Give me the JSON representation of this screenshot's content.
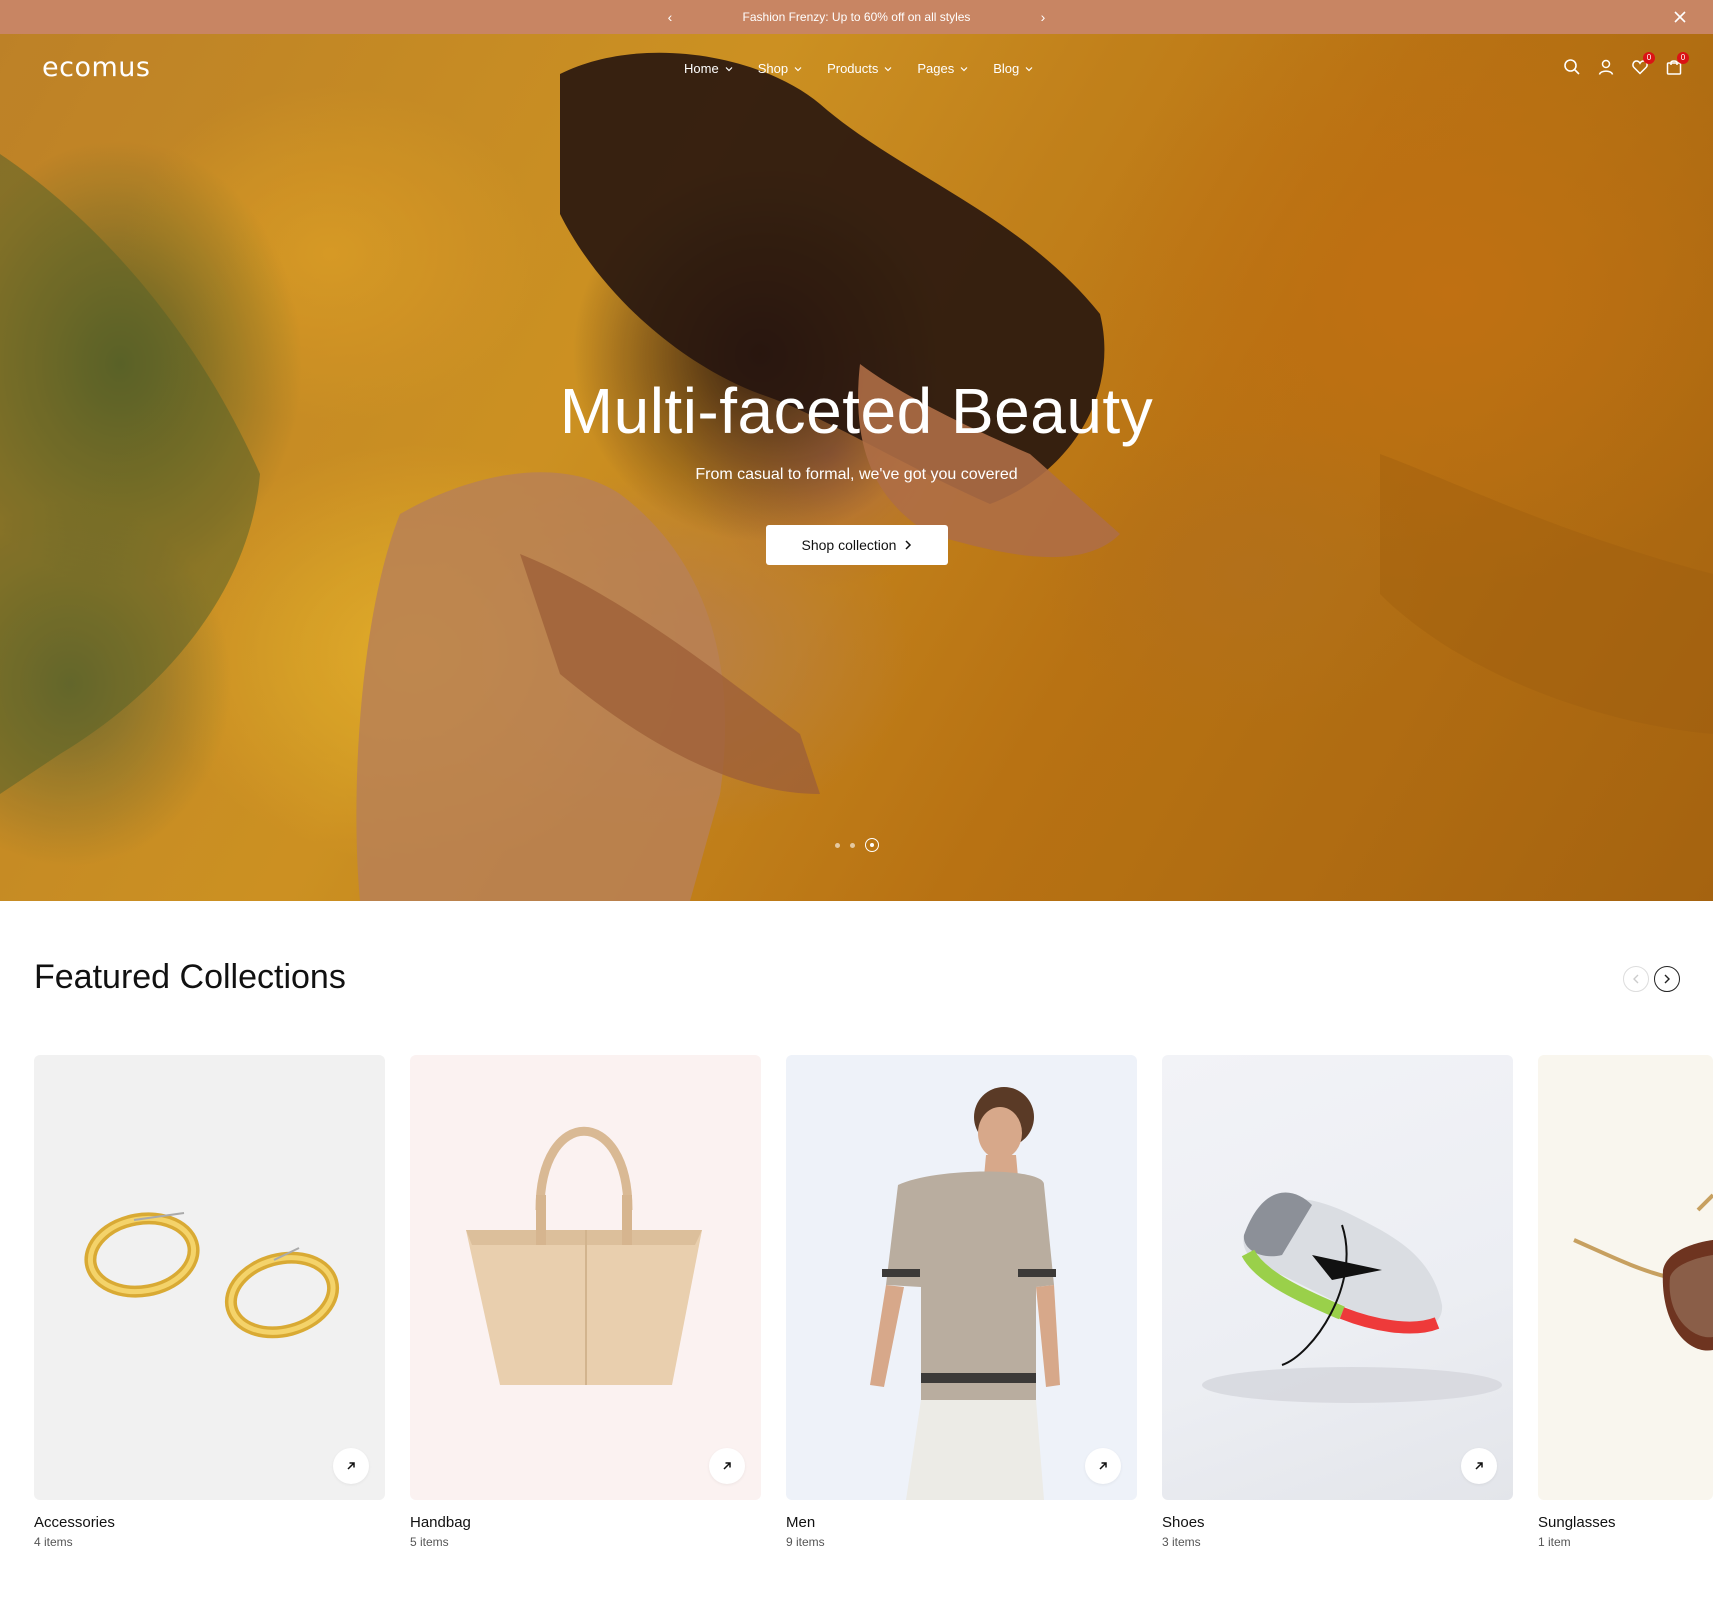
{
  "announcement": {
    "text": "Fashion Frenzy: Up to 60% off on all styles"
  },
  "header": {
    "logo": "ecomus",
    "nav": [
      {
        "label": "Home"
      },
      {
        "label": "Shop"
      },
      {
        "label": "Products"
      },
      {
        "label": "Pages"
      },
      {
        "label": "Blog"
      }
    ],
    "wishlist_count": "0",
    "cart_count": "0"
  },
  "hero": {
    "title": "Multi-faceted Beauty",
    "subtitle": "From casual to formal, we've got you covered",
    "cta": "Shop collection",
    "slides_total": 3,
    "active_slide": 3
  },
  "featured": {
    "title": "Featured Collections",
    "items": [
      {
        "name": "Accessories",
        "count": "4 items",
        "icon": "earrings-image"
      },
      {
        "name": "Handbag",
        "count": "5 items",
        "icon": "handbag-image"
      },
      {
        "name": "Men",
        "count": "9 items",
        "icon": "men-image"
      },
      {
        "name": "Shoes",
        "count": "3 items",
        "icon": "sneaker-image"
      },
      {
        "name": "Sunglasses",
        "count": "1 item",
        "icon": "sunglasses-image"
      }
    ]
  },
  "colors": {
    "announcement_bg": "#c88563",
    "badge": "#db1215",
    "hero_bg": "#d99a25"
  }
}
